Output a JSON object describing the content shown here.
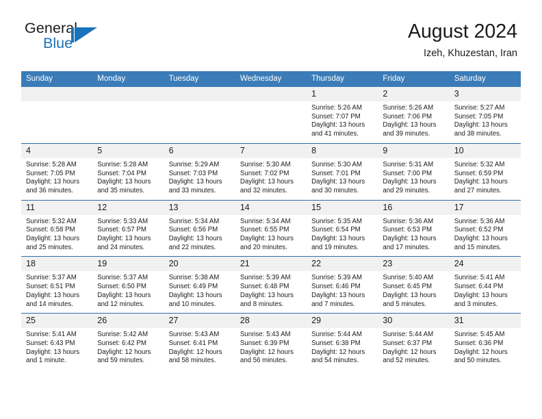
{
  "brand": {
    "name_part1": "General",
    "name_part2": "Blue",
    "logo_icon": "triangle-flag-icon",
    "accent_color": "#1a72bb"
  },
  "header": {
    "title": "August 2024",
    "location": "Izeh, Khuzestan, Iran",
    "header_bg_color": "#3b7cb8",
    "daynum_bg_color": "#f1f1f1",
    "row_border_color": "#2f6ca6"
  },
  "calendar": {
    "weekday_headers": [
      "Sunday",
      "Monday",
      "Tuesday",
      "Wednesday",
      "Thursday",
      "Friday",
      "Saturday"
    ],
    "weeks": [
      [
        {
          "day": "",
          "lines": []
        },
        {
          "day": "",
          "lines": []
        },
        {
          "day": "",
          "lines": []
        },
        {
          "day": "",
          "lines": []
        },
        {
          "day": "1",
          "lines": [
            "Sunrise: 5:26 AM",
            "Sunset: 7:07 PM",
            "Daylight: 13 hours",
            "and 41 minutes."
          ]
        },
        {
          "day": "2",
          "lines": [
            "Sunrise: 5:26 AM",
            "Sunset: 7:06 PM",
            "Daylight: 13 hours",
            "and 39 minutes."
          ]
        },
        {
          "day": "3",
          "lines": [
            "Sunrise: 5:27 AM",
            "Sunset: 7:05 PM",
            "Daylight: 13 hours",
            "and 38 minutes."
          ]
        }
      ],
      [
        {
          "day": "4",
          "lines": [
            "Sunrise: 5:28 AM",
            "Sunset: 7:05 PM",
            "Daylight: 13 hours",
            "and 36 minutes."
          ]
        },
        {
          "day": "5",
          "lines": [
            "Sunrise: 5:28 AM",
            "Sunset: 7:04 PM",
            "Daylight: 13 hours",
            "and 35 minutes."
          ]
        },
        {
          "day": "6",
          "lines": [
            "Sunrise: 5:29 AM",
            "Sunset: 7:03 PM",
            "Daylight: 13 hours",
            "and 33 minutes."
          ]
        },
        {
          "day": "7",
          "lines": [
            "Sunrise: 5:30 AM",
            "Sunset: 7:02 PM",
            "Daylight: 13 hours",
            "and 32 minutes."
          ]
        },
        {
          "day": "8",
          "lines": [
            "Sunrise: 5:30 AM",
            "Sunset: 7:01 PM",
            "Daylight: 13 hours",
            "and 30 minutes."
          ]
        },
        {
          "day": "9",
          "lines": [
            "Sunrise: 5:31 AM",
            "Sunset: 7:00 PM",
            "Daylight: 13 hours",
            "and 29 minutes."
          ]
        },
        {
          "day": "10",
          "lines": [
            "Sunrise: 5:32 AM",
            "Sunset: 6:59 PM",
            "Daylight: 13 hours",
            "and 27 minutes."
          ]
        }
      ],
      [
        {
          "day": "11",
          "lines": [
            "Sunrise: 5:32 AM",
            "Sunset: 6:58 PM",
            "Daylight: 13 hours",
            "and 25 minutes."
          ]
        },
        {
          "day": "12",
          "lines": [
            "Sunrise: 5:33 AM",
            "Sunset: 6:57 PM",
            "Daylight: 13 hours",
            "and 24 minutes."
          ]
        },
        {
          "day": "13",
          "lines": [
            "Sunrise: 5:34 AM",
            "Sunset: 6:56 PM",
            "Daylight: 13 hours",
            "and 22 minutes."
          ]
        },
        {
          "day": "14",
          "lines": [
            "Sunrise: 5:34 AM",
            "Sunset: 6:55 PM",
            "Daylight: 13 hours",
            "and 20 minutes."
          ]
        },
        {
          "day": "15",
          "lines": [
            "Sunrise: 5:35 AM",
            "Sunset: 6:54 PM",
            "Daylight: 13 hours",
            "and 19 minutes."
          ]
        },
        {
          "day": "16",
          "lines": [
            "Sunrise: 5:36 AM",
            "Sunset: 6:53 PM",
            "Daylight: 13 hours",
            "and 17 minutes."
          ]
        },
        {
          "day": "17",
          "lines": [
            "Sunrise: 5:36 AM",
            "Sunset: 6:52 PM",
            "Daylight: 13 hours",
            "and 15 minutes."
          ]
        }
      ],
      [
        {
          "day": "18",
          "lines": [
            "Sunrise: 5:37 AM",
            "Sunset: 6:51 PM",
            "Daylight: 13 hours",
            "and 14 minutes."
          ]
        },
        {
          "day": "19",
          "lines": [
            "Sunrise: 5:37 AM",
            "Sunset: 6:50 PM",
            "Daylight: 13 hours",
            "and 12 minutes."
          ]
        },
        {
          "day": "20",
          "lines": [
            "Sunrise: 5:38 AM",
            "Sunset: 6:49 PM",
            "Daylight: 13 hours",
            "and 10 minutes."
          ]
        },
        {
          "day": "21",
          "lines": [
            "Sunrise: 5:39 AM",
            "Sunset: 6:48 PM",
            "Daylight: 13 hours",
            "and 8 minutes."
          ]
        },
        {
          "day": "22",
          "lines": [
            "Sunrise: 5:39 AM",
            "Sunset: 6:46 PM",
            "Daylight: 13 hours",
            "and 7 minutes."
          ]
        },
        {
          "day": "23",
          "lines": [
            "Sunrise: 5:40 AM",
            "Sunset: 6:45 PM",
            "Daylight: 13 hours",
            "and 5 minutes."
          ]
        },
        {
          "day": "24",
          "lines": [
            "Sunrise: 5:41 AM",
            "Sunset: 6:44 PM",
            "Daylight: 13 hours",
            "and 3 minutes."
          ]
        }
      ],
      [
        {
          "day": "25",
          "lines": [
            "Sunrise: 5:41 AM",
            "Sunset: 6:43 PM",
            "Daylight: 13 hours",
            "and 1 minute."
          ]
        },
        {
          "day": "26",
          "lines": [
            "Sunrise: 5:42 AM",
            "Sunset: 6:42 PM",
            "Daylight: 12 hours",
            "and 59 minutes."
          ]
        },
        {
          "day": "27",
          "lines": [
            "Sunrise: 5:43 AM",
            "Sunset: 6:41 PM",
            "Daylight: 12 hours",
            "and 58 minutes."
          ]
        },
        {
          "day": "28",
          "lines": [
            "Sunrise: 5:43 AM",
            "Sunset: 6:39 PM",
            "Daylight: 12 hours",
            "and 56 minutes."
          ]
        },
        {
          "day": "29",
          "lines": [
            "Sunrise: 5:44 AM",
            "Sunset: 6:38 PM",
            "Daylight: 12 hours",
            "and 54 minutes."
          ]
        },
        {
          "day": "30",
          "lines": [
            "Sunrise: 5:44 AM",
            "Sunset: 6:37 PM",
            "Daylight: 12 hours",
            "and 52 minutes."
          ]
        },
        {
          "day": "31",
          "lines": [
            "Sunrise: 5:45 AM",
            "Sunset: 6:36 PM",
            "Daylight: 12 hours",
            "and 50 minutes."
          ]
        }
      ]
    ]
  }
}
